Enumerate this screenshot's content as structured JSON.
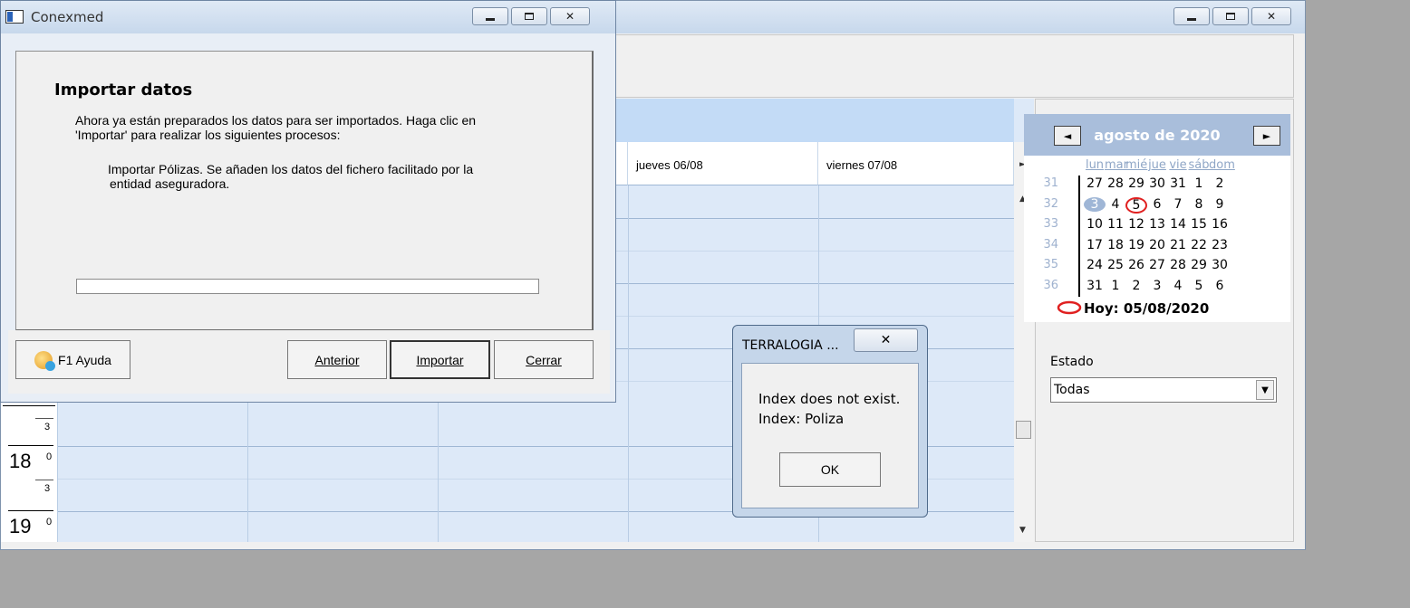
{
  "main_window": {
    "grid": {
      "columns": [
        {
          "label": ""
        },
        {
          "label": ""
        },
        {
          "label": ""
        },
        {
          "label": "jueves 06/08"
        },
        {
          "label": "viernes 07/08"
        }
      ],
      "time_rows": [
        {
          "hour": "",
          "sub": "3"
        },
        {
          "hour": "18",
          "sup": "0",
          "sub": "3"
        },
        {
          "hour": "19",
          "sup": "0"
        }
      ],
      "scroll_right": "►",
      "scroll_up": "▲",
      "scroll_down": "▼"
    },
    "calendar": {
      "prev": "◄",
      "next": "►",
      "month_label": "agosto de 2020",
      "weekdays": [
        "lun",
        "mar",
        "mié",
        "jue",
        "vie",
        "sáb",
        "dom"
      ],
      "weeks": [
        {
          "num": "31",
          "days": [
            "27",
            "28",
            "29",
            "30",
            "31",
            "1",
            "2"
          ]
        },
        {
          "num": "32",
          "days": [
            "3",
            "4",
            "5",
            "6",
            "7",
            "8",
            "9"
          ]
        },
        {
          "num": "33",
          "days": [
            "10",
            "11",
            "12",
            "13",
            "14",
            "15",
            "16"
          ]
        },
        {
          "num": "34",
          "days": [
            "17",
            "18",
            "19",
            "20",
            "21",
            "22",
            "23"
          ]
        },
        {
          "num": "35",
          "days": [
            "24",
            "25",
            "26",
            "27",
            "28",
            "29",
            "30"
          ]
        },
        {
          "num": "36",
          "days": [
            "31",
            "1",
            "2",
            "3",
            "4",
            "5",
            "6"
          ]
        }
      ],
      "today_label": "Hoy: 05/08/2020",
      "today_color": "#e02020",
      "selected_color": "#9fb6d6"
    },
    "estado": {
      "label": "Estado",
      "value": "Todas",
      "arrow": "▼"
    }
  },
  "conexmed": {
    "title": "Conexmed",
    "heading": "Importar datos",
    "intro_line1": "Ahora ya están preparados los datos para ser importados. Haga clic en",
    "intro_line2": "'Importar' para realizar los siguientes procesos:",
    "detail_line1": "Importar Pólizas. Se añaden los datos del fichero facilitado por la",
    "detail_line2": "entidad aseguradora.",
    "progress": 0,
    "buttons": {
      "help": "F1 Ayuda",
      "back": "Anterior",
      "import": "Importar",
      "close": "Cerrar"
    }
  },
  "message_box": {
    "title": "TERRALOGIA ...",
    "line1": "Index does not exist.",
    "line2": "Index: Poliza",
    "ok": "OK"
  }
}
